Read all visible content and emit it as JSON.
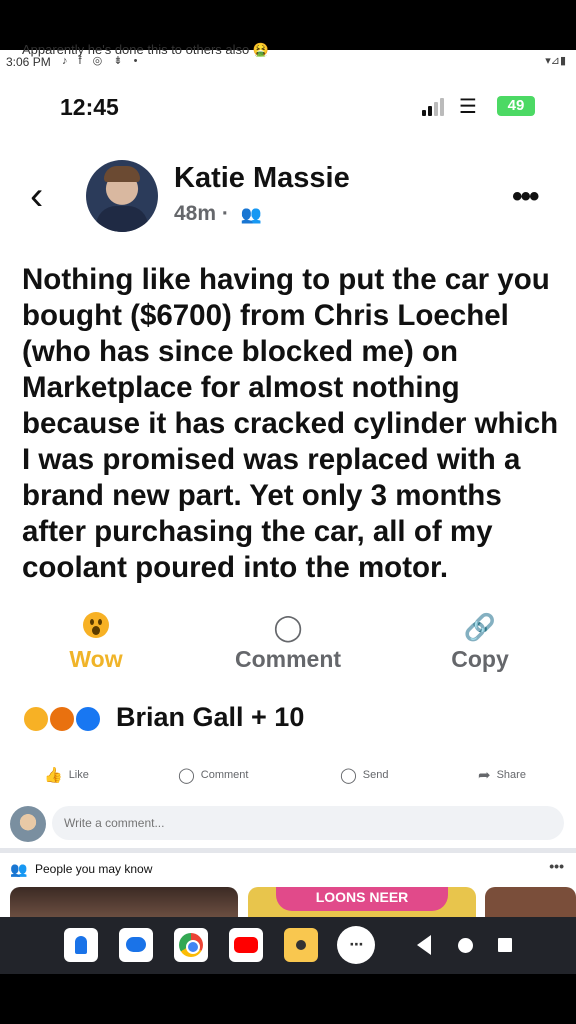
{
  "outer_status": {
    "overlap_text": "Apparently he's done this to others also 🤮",
    "time": "3:06 PM",
    "icons": "♪ f ◎ ⇟ •",
    "right": "▾⊿▮"
  },
  "phone_status": {
    "time": "12:45",
    "battery": "49"
  },
  "post": {
    "author": "Katie Massie",
    "time_ago": "48m",
    "separator": "·",
    "text": "Nothing like having to put the car you bought ($6700) from Chris Loechel (who has since blocked me) on Marketplace for almost nothing because it has cracked cylinder which I was promised was replaced with a brand new part.  Yet only 3 months after purchasing the car, all of my coolant poured into the motor."
  },
  "reaction_buttons": {
    "wow_label": "Wow",
    "comment_label": "Comment",
    "copy_label": "Copy"
  },
  "reactions_summary": {
    "names": "Brian Gall + 10"
  },
  "actions": {
    "like": "Like",
    "comment": "Comment",
    "send": "Send",
    "share": "Share"
  },
  "comment_box": {
    "placeholder": "Write a comment..."
  },
  "people_you_may_know": {
    "title": "People you may know",
    "card_banner": "LOONS NEER"
  },
  "icons": {
    "back": "chevron-left-icon",
    "more": "more-horizontal-icon",
    "audience": "friends-icon",
    "wow": "wow-emoji-icon",
    "comment": "comment-bubble-icon",
    "copy": "link-icon"
  },
  "colors": {
    "wow_label": "#f0b429",
    "battery": "#4cd964",
    "like_blue": "#1877f2"
  }
}
